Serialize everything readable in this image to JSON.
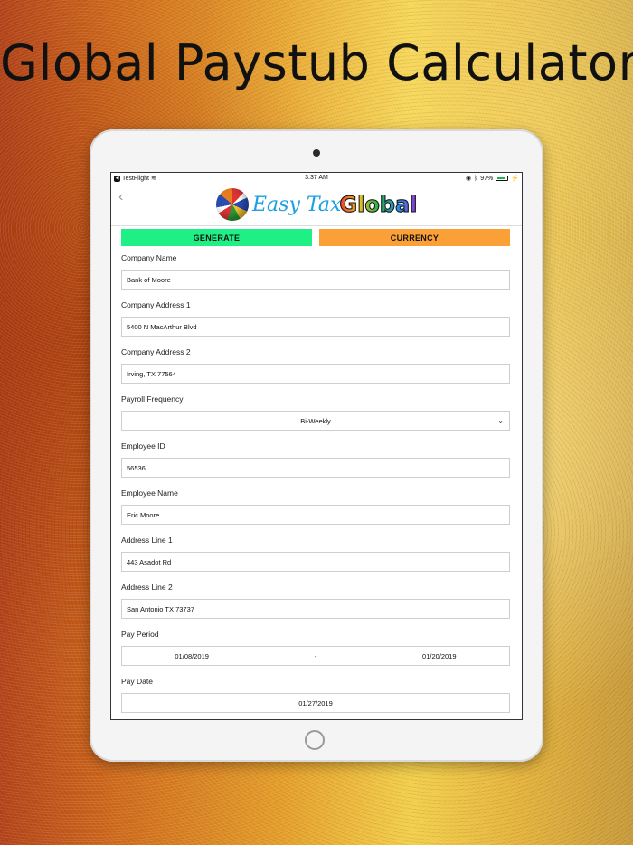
{
  "headline": "Global Paystub Calculator",
  "statusbar": {
    "carrier": "TestFlight",
    "time": "3:37 AM",
    "battery": "97%"
  },
  "logo": {
    "easy": "Easy Tax",
    "global": "Global"
  },
  "buttons": {
    "generate": "GENERATE",
    "currency": "CURRENCY"
  },
  "fields": {
    "company_name": {
      "label": "Company Name",
      "value": "Bank of Moore"
    },
    "company_address_1": {
      "label": "Company Address 1",
      "value": "5400 N MacArthur Blvd"
    },
    "company_address_2": {
      "label": "Company Address 2",
      "value": "Irving, TX 77564"
    },
    "payroll_frequency": {
      "label": "Payroll Frequency",
      "value": "Bi-Weekly"
    },
    "employee_id": {
      "label": "Employee ID",
      "value": "56536"
    },
    "employee_name": {
      "label": "Employee Name",
      "value": "Eric Moore"
    },
    "address_line_1": {
      "label": "Address Line 1",
      "value": "443 Asadot Rd"
    },
    "address_line_2": {
      "label": "Address Line 2",
      "value": "San Antonio TX 73737"
    },
    "pay_period": {
      "label": "Pay Period",
      "start": "01/08/2019",
      "separator": "-",
      "end": "01/20/2019"
    },
    "pay_date": {
      "label": "Pay Date",
      "value": "01/27/2019"
    }
  },
  "colors": {
    "generate": "#1ef086",
    "currency": "#fb9f37"
  }
}
